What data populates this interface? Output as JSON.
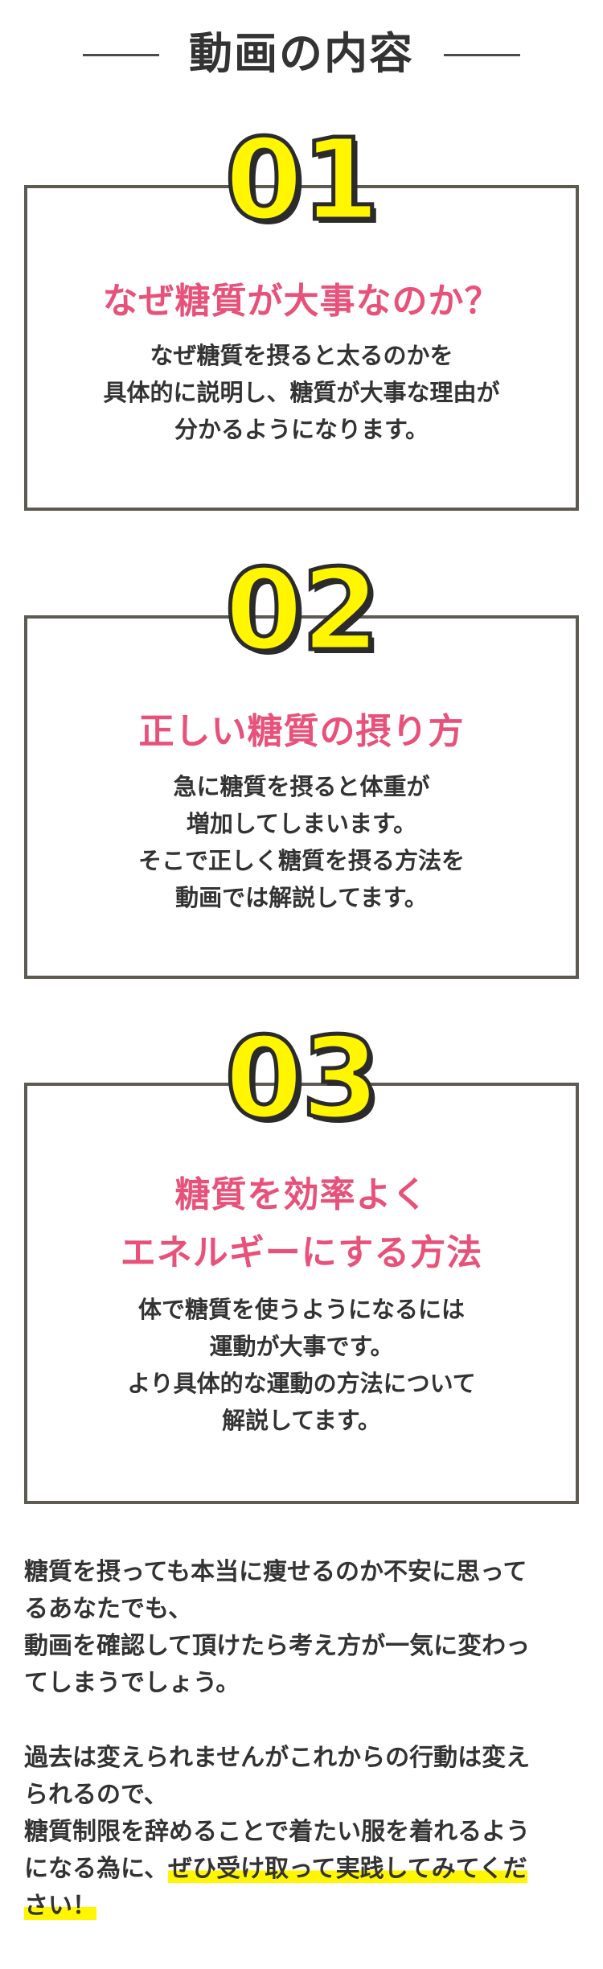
{
  "heading": {
    "title": "動画の内容"
  },
  "items": [
    {
      "number": "01",
      "title_lines": [
        "なぜ糖質が大事なのか？"
      ],
      "body_lines": [
        "なぜ糖質を摂ると太るのかを",
        "具体的に説明し、糖質が大事な理由が",
        "分かるようになります。"
      ]
    },
    {
      "number": "02",
      "title_lines": [
        "正しい糖質の摂り方"
      ],
      "body_lines": [
        "急に糖質を摂ると体重が",
        "増加してしまいます。",
        "そこで正しく糖質を摂る方法を",
        "動画では解説してます。"
      ]
    },
    {
      "number": "03",
      "title_lines": [
        "糖質を効率よく",
        "エネルギーにする方法"
      ],
      "body_lines": [
        "体で糖質を使うようになるには",
        "運動が大事です。",
        "より具体的な運動の方法について",
        "解説してます。"
      ]
    }
  ],
  "paragraph1": [
    "糖質を摂っても本当に痩せるのか不安に思って",
    "るあなたでも、",
    "動画を確認して頂けたら考え方が一気に変わっ",
    "てしまうでしょう。"
  ],
  "paragraph2": {
    "lines": [
      "過去は変えられませんがこれからの行動は変え",
      "られるので、",
      "糖質制限を辞めることで着たい服を着れるよう"
    ],
    "line4_plain": "になる為に、",
    "line4_highlight": "ぜひ受け取って実践してみてくだ",
    "line5_highlight": "さい！"
  },
  "colors": {
    "accent_pink": "#e8517a",
    "number_yellow": "#fff600",
    "border": "#5d5a52",
    "text": "#333333"
  }
}
